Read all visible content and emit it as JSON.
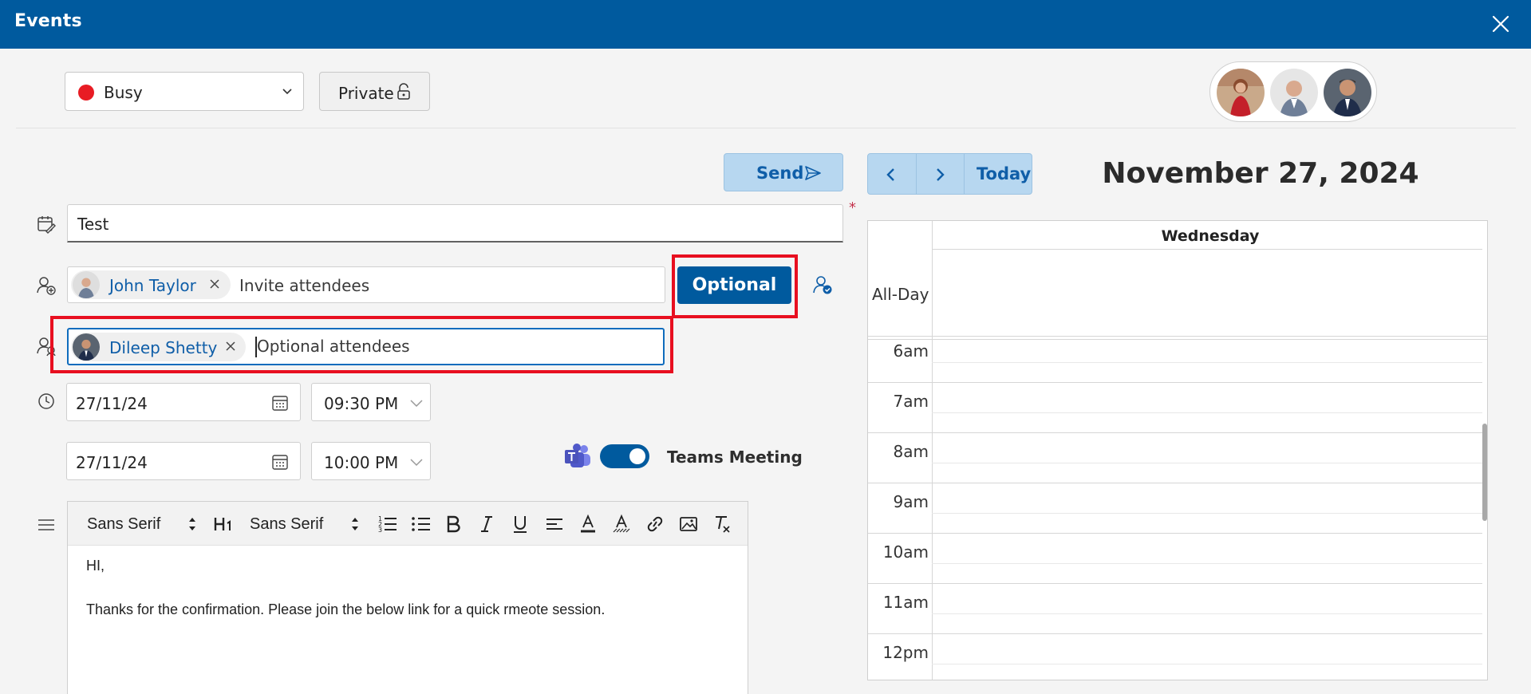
{
  "window": {
    "title": "Events"
  },
  "status": {
    "selected": "Busy",
    "color": "#e81c24"
  },
  "private_label": "Private",
  "send_label": "Send",
  "nav": {
    "today_label": "Today"
  },
  "date_heading": "November 27, 2024",
  "subject": {
    "value": "Test",
    "required_mark": "*"
  },
  "attendees": {
    "chips": [
      {
        "name": "John Taylor"
      }
    ],
    "placeholder": "Invite attendees",
    "optional_button": "Optional"
  },
  "optional_attendees": {
    "chips": [
      {
        "name": "Dileep Shetty"
      }
    ],
    "placeholder": "Optional attendees"
  },
  "start": {
    "date": "27/11/24",
    "time": "09:30 PM"
  },
  "end": {
    "date": "27/11/24",
    "time": "10:00 PM"
  },
  "teams": {
    "label": "Teams Meeting",
    "enabled": true
  },
  "editor": {
    "toolbar": {
      "font1": "Sans Serif",
      "font2": "Sans Serif"
    },
    "body": [
      "HI,",
      "Thanks for the confirmation. Please join the below link for a quick rmeote session."
    ]
  },
  "calendar": {
    "day_name": "Wednesday",
    "all_day_label": "All-Day",
    "hours": [
      "6am",
      "7am",
      "8am",
      "9am",
      "10am",
      "11am",
      "12pm"
    ]
  },
  "colors": {
    "brand": "#005a9e",
    "highlight": "#e80f20",
    "link": "#0f5ea8"
  }
}
